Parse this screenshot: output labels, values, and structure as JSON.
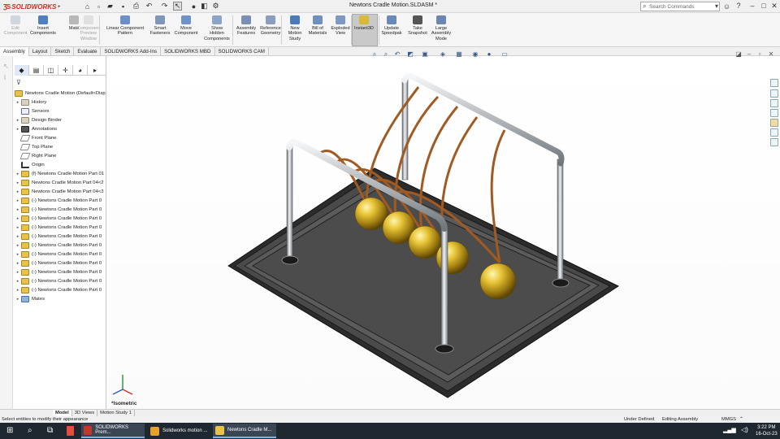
{
  "app": {
    "brand": "SOLIDWORKS",
    "doc_title": "Newtons Cradle Motion.SLDASM *"
  },
  "search": {
    "placeholder": "Search Commands"
  },
  "window_controls": {
    "help": "?",
    "minimize": "–",
    "maximize": "□",
    "close": "✕"
  },
  "ribbon": {
    "buttons": [
      {
        "label": "Edit\nComponent",
        "disabled": true
      },
      {
        "label": "Insert\nComponents"
      },
      {
        "label": "Mate"
      },
      {
        "label": "Component\nPreview\nWindow",
        "disabled": true
      },
      {
        "label": "Linear Component\nPattern"
      },
      {
        "label": "Smart\nFasteners"
      },
      {
        "label": "Move\nComponent"
      },
      {
        "label": "Show\nHidden\nComponents"
      },
      {
        "label": "Assembly\nFeatures"
      },
      {
        "label": "Reference\nGeometry"
      },
      {
        "label": "New\nMotion\nStudy"
      },
      {
        "label": "Bill of\nMaterials"
      },
      {
        "label": "Exploded\nView"
      },
      {
        "label": "Instant3D",
        "active": true
      },
      {
        "label": "Update\nSpeedpak"
      },
      {
        "label": "Take\nSnapshot"
      },
      {
        "label": "Large\nAssembly\nMode"
      }
    ]
  },
  "command_tabs": [
    "Assembly",
    "Layout",
    "Sketch",
    "Evaluate",
    "SOLIDWORKS Add-Ins",
    "SOLIDWORKS MBD",
    "SOLIDWORKS CAM"
  ],
  "tree": {
    "root": "Newtons Cradle Motion  (Default<Disp",
    "items": [
      {
        "label": "History",
        "icon": "folder"
      },
      {
        "label": "Sensors",
        "icon": "sensor"
      },
      {
        "label": "Design Binder",
        "icon": "folder"
      },
      {
        "label": "Annotations",
        "icon": "annotation"
      },
      {
        "label": "Front Plane",
        "icon": "plane"
      },
      {
        "label": "Top Plane",
        "icon": "plane"
      },
      {
        "label": "Right Plane",
        "icon": "plane"
      },
      {
        "label": "Origin",
        "icon": "origin"
      },
      {
        "label": "(f) Newtons Cradle Motion Part 01",
        "icon": "part"
      },
      {
        "label": "Newtons Cradle Motion Part 04<2",
        "icon": "part"
      },
      {
        "label": "Newtons Cradle Motion Part 04<3",
        "icon": "part"
      },
      {
        "label": "(-) Newtons Cradle Motion Part 0",
        "icon": "part"
      },
      {
        "label": "(-) Newtons Cradle Motion Part 0",
        "icon": "part"
      },
      {
        "label": "(-) Newtons Cradle Motion Part 0",
        "icon": "part"
      },
      {
        "label": "(-) Newtons Cradle Motion Part 0",
        "icon": "part"
      },
      {
        "label": "(-) Newtons Cradle Motion Part 0",
        "icon": "part"
      },
      {
        "label": "(-) Newtons Cradle Motion Part 0",
        "icon": "part"
      },
      {
        "label": "(-) Newtons Cradle Motion Part 0",
        "icon": "part"
      },
      {
        "label": "(-) Newtons Cradle Motion Part 0",
        "icon": "part"
      },
      {
        "label": "(-) Newtons Cradle Motion Part 0",
        "icon": "part"
      },
      {
        "label": "(-) Newtons Cradle Motion Part 0",
        "icon": "part"
      },
      {
        "label": "(-) Newtons Cradle Motion Part 0",
        "icon": "part"
      },
      {
        "label": "Mates",
        "icon": "mates"
      }
    ]
  },
  "viewport": {
    "view_label": "*Isometric"
  },
  "bottom_tabs": [
    "Model",
    "3D Views",
    "Motion Study 1"
  ],
  "status": {
    "left": "Select entities to modify their appearance",
    "defined": "Under Defined",
    "mode": "Editing Assembly",
    "units": "MMGS"
  },
  "taskbar": {
    "apps": [
      "SOLIDWORKS Prem...",
      "Solidworks motion ...",
      "Newtons Cradle M..."
    ],
    "time": "3:22 PM",
    "date": "16-Oct-23"
  },
  "colors": {
    "brand_red": "#d52b1e",
    "accent_blue": "#3b5a86",
    "taskbar": "#1f2730",
    "brass": "#c9a21c"
  }
}
